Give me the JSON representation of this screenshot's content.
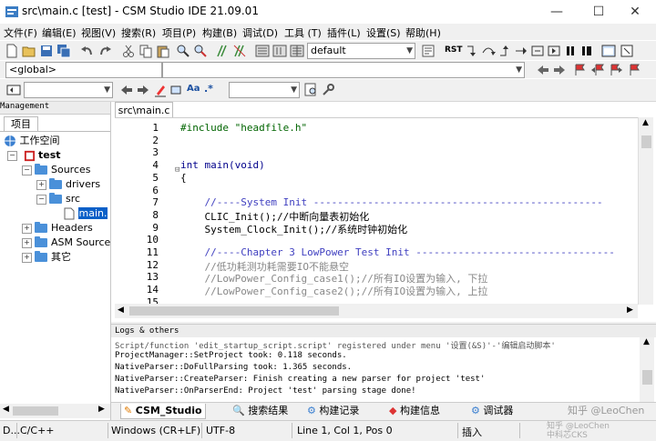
{
  "window": {
    "title": "src\\main.c [test] - CSM Studio IDE 21.09.01",
    "minimize": "—",
    "maximize": "☐",
    "close": "✕"
  },
  "menu": [
    "文件(F)",
    "编辑(E)",
    "视图(V)",
    "搜索(R)",
    "项目(P)",
    "构建(B)",
    "调试(D)",
    "工具 (T)",
    "插件(L)",
    "设置(S)",
    "帮助(H)"
  ],
  "toolbar": {
    "build_target": "default",
    "scope": "<global>",
    "replace_button": "Aa",
    "regex_button": ".*",
    "rst_button": "RST"
  },
  "panel": {
    "header": "Management",
    "project_tab": "项目",
    "tree": {
      "workspace": "工作空间",
      "project": "test",
      "sources": "Sources",
      "drivers": "drivers",
      "src": "src",
      "main_file": "main.",
      "headers": "Headers",
      "asm": "ASM Source",
      "other": "其它"
    }
  },
  "editor": {
    "tab": "src\\main.c",
    "lines": [
      {
        "n": "1",
        "html_class": "pp",
        "text": "#include \"headfile.h\""
      },
      {
        "n": "2",
        "text": ""
      },
      {
        "n": "3",
        "text": ""
      },
      {
        "n": "4",
        "text": "int main(void)"
      },
      {
        "n": "5",
        "text": "{"
      },
      {
        "n": "6",
        "text": ""
      },
      {
        "n": "7",
        "text": "    //----System Init ------------------------------------------------"
      },
      {
        "n": "8",
        "text": "    CLIC_Init();//中断向量表初始化"
      },
      {
        "n": "9",
        "text": "    System_Clock_Init();//系统时钟初始化"
      },
      {
        "n": "10",
        "text": ""
      },
      {
        "n": "11",
        "text": "    //----Chapter 3 LowPower Test Init ---------------------------------"
      },
      {
        "n": "12",
        "text": "    //低功耗测功耗需要IO不能悬空"
      },
      {
        "n": "13",
        "text": "    //LowPower_Config_case1();//所有IO设置为输入, 下拉"
      },
      {
        "n": "14",
        "text": "    //LowPower_Config_case2();//所有IO设置为输入, 上拉"
      },
      {
        "n": "15",
        "text": ""
      }
    ]
  },
  "logs": {
    "title": "Logs & others",
    "lines": [
      "Script/function 'edit_startup_script.script' registered under menu '设置(&S)'-'编辑启动脚本'",
      "ProjectManager::SetProject took: 0.118 seconds.",
      "NativeParser::DoFullParsing took: 1.365 seconds.",
      "NativeParser::CreateParser: Finish creating a new parser for project 'test'",
      "NativeParser::OnParserEnd: Project 'test' parsing stage done!"
    ]
  },
  "bottom_tabs": [
    "CSM_Studio",
    "搜索结果",
    "构建记录",
    "构建信息",
    "调试器",
    "知乎 @LeoChen"
  ],
  "status": {
    "mode": "D...",
    "language": "C/C++",
    "eol": "Windows (CR+LF)",
    "encoding": "UTF-8",
    "position": "Line 1, Col 1, Pos 0",
    "insert": "插入",
    "watermark": "知乎 @LeoChen\n中科芯CKS"
  },
  "colors": {
    "folder": "#4a90d9",
    "keyword": "#00008b",
    "comment": "#888888",
    "string": "#a000a0"
  }
}
